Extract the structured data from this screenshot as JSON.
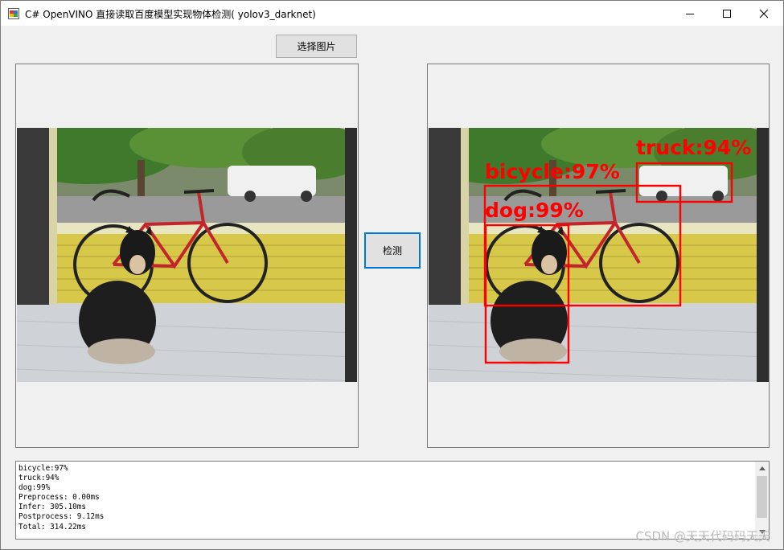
{
  "window": {
    "title": "C# OpenVINO 直接读取百度模型实现物体检测( yolov3_darknet)",
    "controls": {
      "minimize": "minimize-icon",
      "maximize": "maximize-icon",
      "close": "close-icon"
    }
  },
  "toolbar": {
    "select_image_label": "选择图片",
    "detect_label": "检测"
  },
  "detections": [
    {
      "label": "bicycle:97%"
    },
    {
      "label": "truck:94%"
    },
    {
      "label": "dog:99%"
    }
  ],
  "log": {
    "lines": [
      "bicycle:97%",
      "truck:94%",
      "dog:99%",
      "Preprocess: 0.00ms",
      "Infer: 305.10ms",
      "Postprocess: 9.12ms",
      "Total: 314.22ms"
    ]
  },
  "watermark": "CSDN @天天代码码天天",
  "colors": {
    "box": "#ff0000",
    "accent": "#0078d7"
  }
}
